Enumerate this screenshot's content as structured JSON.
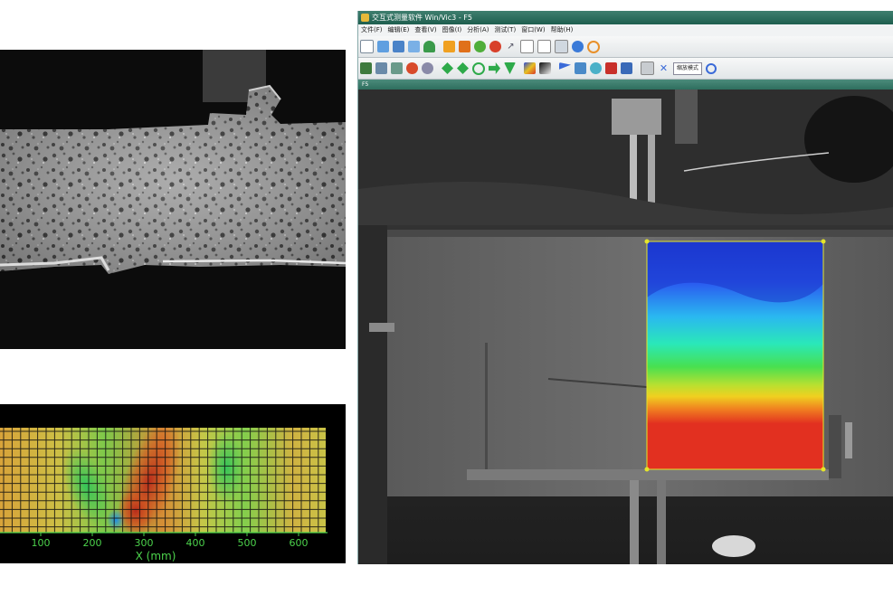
{
  "strain_map": {
    "axis_label": "X (mm)",
    "ticks": [
      "100",
      "200",
      "300",
      "400",
      "500",
      "600"
    ],
    "tick_values": [
      100,
      200,
      300,
      400,
      500,
      600
    ]
  },
  "app": {
    "title": "交互式测量软件  Win/Vic3 - F5",
    "menus": [
      "文件(F)",
      "编辑(E)",
      "查看(V)",
      "图像(I)",
      "分析(A)",
      "测试(T)",
      "窗口(W)",
      "帮助(H)"
    ],
    "inner_window_title": "F5",
    "mode_select": "缩放模式",
    "colors": {
      "titlebar": "#2f6f5f",
      "map_top": "#1e3ad8",
      "map_bottom": "#e23020",
      "roi_handle": "#e5e52a"
    },
    "icons_row1": [
      "new-icon",
      "open-icon",
      "save-icon",
      "save-as-icon",
      "shield-icon",
      "image-icon",
      "image-stack-icon",
      "plant-icon",
      "apple-icon",
      "arrow-icon",
      "doc-icon",
      "page-icon",
      "export-icon",
      "info-icon",
      "refresh-icon"
    ],
    "icons_row2": [
      "camera-icon",
      "calibrate-icon",
      "calibrate-2-icon",
      "stop-icon",
      "search-settings-icon",
      "run-icon",
      "step-icon",
      "loop-icon",
      "forward-icon",
      "down-icon",
      "image-color-icon",
      "image-bw-icon",
      "flag-icon",
      "layers-icon",
      "grid-icon",
      "chart-icon",
      "monitor-icon",
      "print-icon",
      "tools-icon",
      "zoom-icon"
    ]
  }
}
